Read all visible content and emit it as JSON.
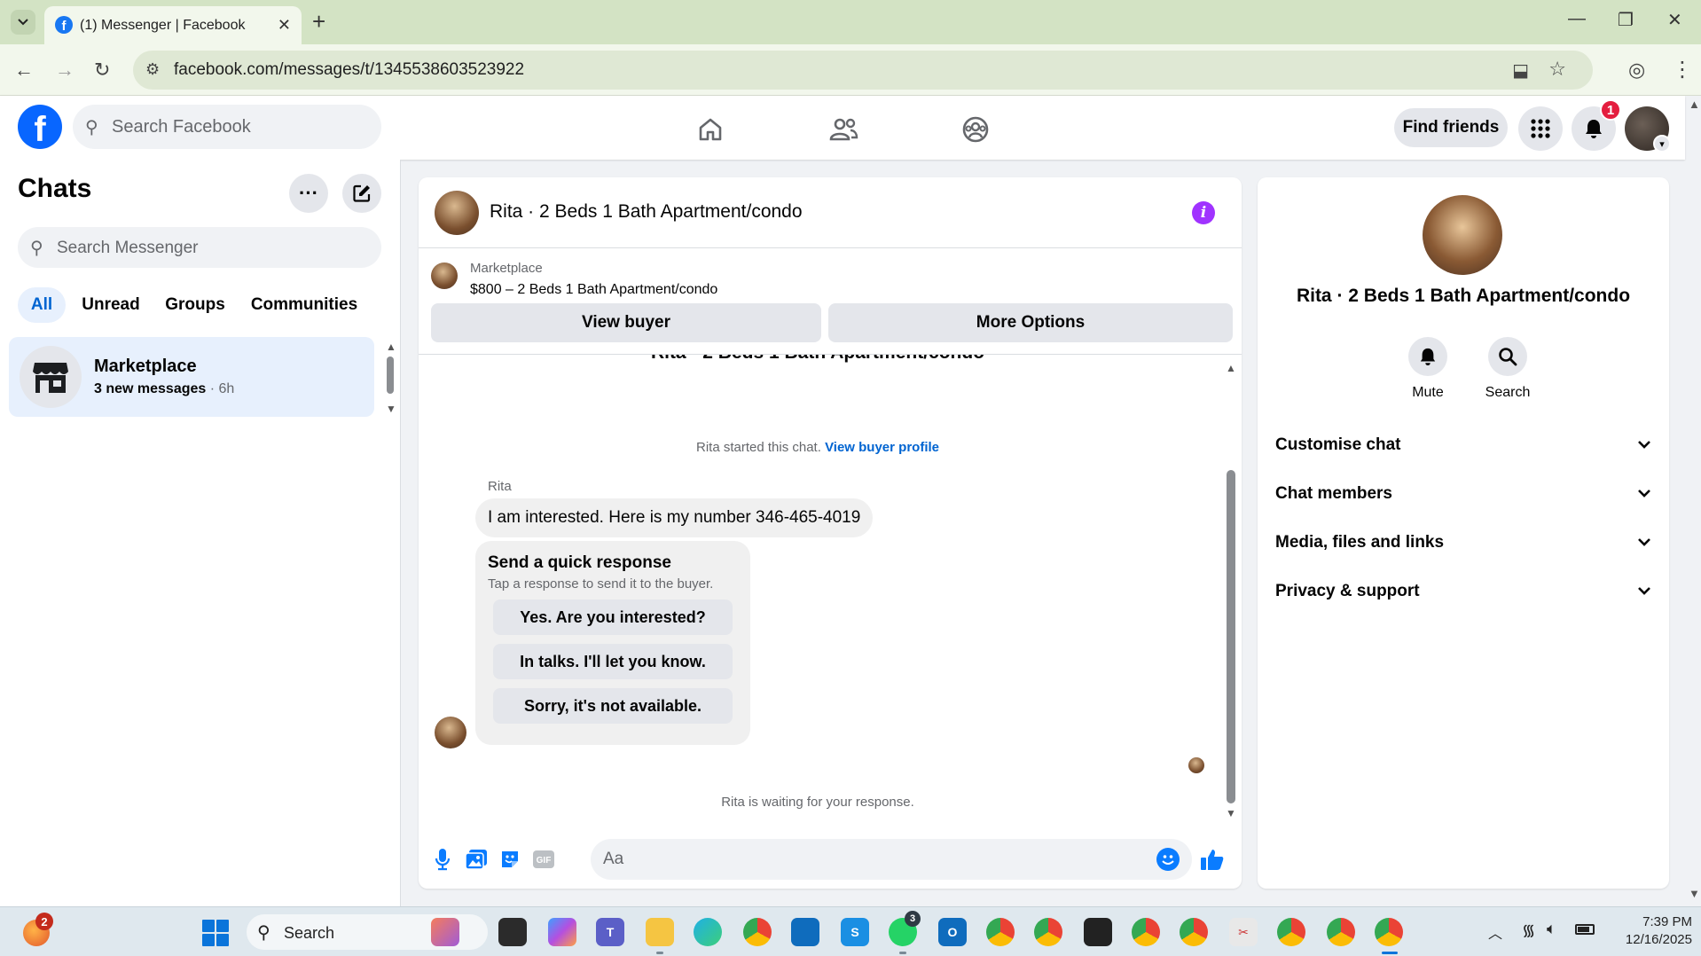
{
  "browser": {
    "tab_title": "(1) Messenger | Facebook",
    "url": "facebook.com/messages/t/1345538603523922"
  },
  "fb_header": {
    "search_placeholder": "Search Facebook",
    "find_friends": "Find friends",
    "notification_count": "1"
  },
  "chats": {
    "title": "Chats",
    "search_placeholder": "Search Messenger",
    "filters": [
      "All",
      "Unread",
      "Groups",
      "Communities"
    ],
    "active_filter": "All",
    "items": [
      {
        "name": "Marketplace",
        "unread": "3 new messages",
        "time": "· 6h"
      }
    ]
  },
  "conversation": {
    "title": "Rita · 2 Beds 1 Bath Apartment/condo",
    "marketplace_label": "Marketplace",
    "listing": "$800 – 2 Beds 1 Bath Apartment/condo",
    "view_buyer": "View buyer",
    "more_options": "More Options",
    "started_text": "Rita started this chat.",
    "view_buyer_profile": "View buyer profile",
    "sender": "Rita",
    "message": "I am interested. Here is my number 346-465-4019",
    "quick_response": {
      "title": "Send a quick response",
      "subtitle": "Tap a response to send it to the buyer.",
      "options": [
        "Yes. Are you interested?",
        "In talks. I'll let you know.",
        "Sorry, it's not available."
      ]
    },
    "waiting_text": "Rita is waiting for your response.",
    "composer_placeholder": "Aa"
  },
  "details": {
    "name": "Rita · 2 Beds 1 Bath Apartment/condo",
    "actions": [
      "Mute",
      "Search"
    ],
    "sections": [
      "Customise chat",
      "Chat members",
      "Media, files and links",
      "Privacy & support"
    ]
  },
  "taskbar": {
    "widget_badge": "2",
    "search_label": "Search",
    "whatsapp_badge": "3",
    "time": "7:39 PM",
    "date": "12/16/2025"
  },
  "colors": {
    "fb_blue": "#0866ff",
    "selected_bg": "#e7f0fd",
    "selected_text": "#0064d1",
    "info_purple": "#a033ff",
    "badge_red": "#e41e3f"
  },
  "icons": [
    "home-icon",
    "friends-icon",
    "groups-icon",
    "menu-grid-icon",
    "bell-icon",
    "mic-icon",
    "photo-icon",
    "sticker-icon",
    "gif-icon",
    "emoji-icon",
    "like-icon",
    "mute-bell-icon",
    "search-icon"
  ]
}
